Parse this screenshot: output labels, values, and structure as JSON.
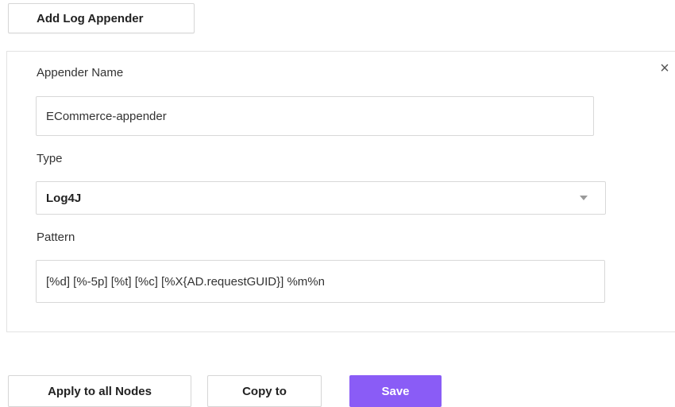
{
  "header": {
    "add_button_label": "Add Log Appender"
  },
  "form": {
    "close_icon": "×",
    "appender_name_label": "Appender Name",
    "appender_name_value": "ECommerce-appender",
    "type_label": "Type",
    "type_value": "Log4J",
    "pattern_label": "Pattern",
    "pattern_value": "[%d] [%-5p] [%t] [%c] [%X{AD.requestGUID}] %m%n"
  },
  "footer": {
    "apply_label": "Apply to all Nodes",
    "copy_label": "Copy to",
    "save_label": "Save"
  },
  "colors": {
    "save_button": "#8a5cf6"
  }
}
